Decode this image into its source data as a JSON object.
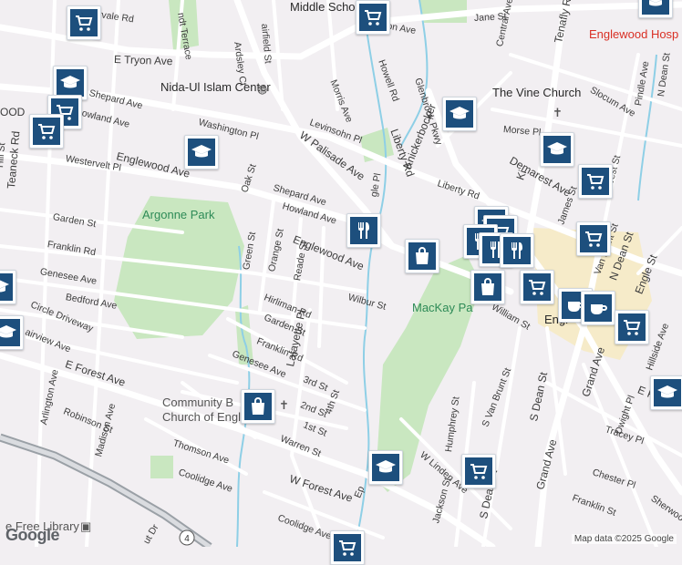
{
  "streets": {
    "fairview": "rvale Rd",
    "terrace": "ndt Terrace",
    "ardsley": "Ardsley Ct",
    "fairfield": "airfield St",
    "etryon": "E Tryon Ave",
    "tryon": "Tryon Ave",
    "jane": "Jane St",
    "central": "Central Ave",
    "tenafly": "Tenafly Rd",
    "morris": "Morris Ave",
    "howell": "Howell Rd",
    "glenbrook": "Glenbrook Pkwy",
    "levinsohn": "Levinsohn Pl",
    "shepard_w": "Shepard Ave",
    "howland_w": "owland Ave",
    "washington": "Washington Pl",
    "teaneck": "Teaneck Rd",
    "westervelt": "Westervelt Pl",
    "englewood_w": "Englewood Ave",
    "wpalisade": "W Palisade Ave",
    "liberty": "Liberty Rd",
    "knickerbocker": "Knickerbocker",
    "morse": "Morse Pl",
    "slocum": "Slocum Ave",
    "demarest": "Demarest Ave",
    "oak": "Oak St",
    "shepard": "Shepard Ave",
    "howland": "Howland Ave",
    "englewood": "Englewood Ave",
    "garden_w": "Garden St",
    "franklin_w": "Franklin Rd",
    "genesee_w": "Genesee Ave",
    "bedford": "Bedford Ave",
    "circle": "Circle Driveway",
    "fairview2": "airview Ave",
    "green": "Green St",
    "orange": "Orange St",
    "reade": "Reade St",
    "hirliman": "Hirliman Rd",
    "garden": "Garden St",
    "wilbur": "Wilbur St",
    "lafayette": "Lafayette Pl",
    "franklin": "Franklin Rd",
    "third": "3rd St",
    "genesee": "Genesee Ave",
    "second": "2nd St",
    "first": "1st St",
    "fourth": "4th St",
    "warren": "Warren St",
    "eforest": "E Forest Ave",
    "arlington": "Arlington Ave",
    "robinson": "Robinson St",
    "madison": "Madison Ave",
    "thomson": "Thomson Ave",
    "coolidge": "Coolidge Ave",
    "wforest": "W Forest Ave",
    "coolidge2": "Coolidge Ave",
    "wlinden": "W Linden Ave",
    "humphrey": "Humphrey St",
    "svanbrunt": "S Van Brunt St",
    "jackson": "Jackson St",
    "sdean": "S Dean St",
    "sdean2": "S Dean St",
    "grand": "Grand Ave",
    "tracey": "Tracey Pl",
    "chester": "Chester Pl",
    "franklin_e": "Franklin St",
    "sherwood": "Sherwood",
    "william": "William St",
    "james": "James St",
    "west": "West St",
    "vanbrunt": "Van Brunt St",
    "dean": "N Dean St",
    "engle": "Engle St",
    "hillside": "Hillside Ave",
    "pindle": "Pindle Ave",
    "ndean": "N Dean St",
    "dwight": "Dwight Pl",
    "liberty2": "Liberty Rd",
    "garden_far": "Garden St",
    "ridge": "Ridge Pl",
    "epalisade": "E Pa",
    "dean_e": "Dean",
    "glenw": "gle Pl",
    "ki": "Ki",
    "bwd": "OOD",
    "ut": "ut Dr",
    "ep": "Ep",
    "hill": "Hill St"
  },
  "places": {
    "middle_school": "Middle Scho",
    "nida": "Nida-Ul Islam Center",
    "vine": "The Vine Church",
    "hospital": "Englewood Hosp",
    "argonne": "Argonne Park",
    "mackay": "MacKay Pa",
    "community": "Community B",
    "church": "Church of Engle",
    "library": "e Free Library",
    "engl": "Engl"
  },
  "colors": {
    "park": "#c9e7c0",
    "water": "#8ecfe6",
    "road": "#ffffff",
    "highway": "#9aa0a6",
    "pin": "#1d4f7d",
    "downtown": "#f6ebc9"
  },
  "icons": [
    "cart-icon",
    "graduation-cap-icon",
    "restaurant-icon",
    "shopping-bag-icon",
    "coffee-icon"
  ],
  "footer": {
    "logo": "Google",
    "attribution": "Map data ©2025 Google"
  },
  "route": "4"
}
